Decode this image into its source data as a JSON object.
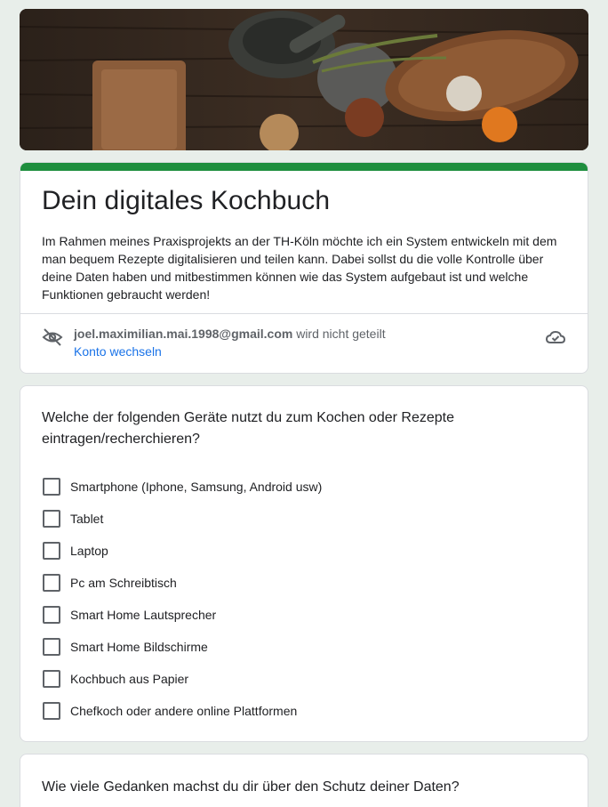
{
  "header": {
    "title": "Dein digitales Kochbuch",
    "description": "Im Rahmen meines Praxisprojekts an der TH-Köln möchte ich ein System entwickeln mit dem man bequem Rezepte digitalisieren und teilen kann. Dabei sollst du die volle Kontrolle über deine Daten haben und mitbestimmen können wie das System aufgebaut ist und welche Funktionen gebraucht werden!",
    "accent_color": "#1e8e3e"
  },
  "account": {
    "email": "joel.maximilian.mai.1998@gmail.com",
    "status": "wird nicht geteilt",
    "switch_label": "Konto wechseln",
    "icons": [
      "eye-off-icon",
      "cloud-done-icon"
    ]
  },
  "question1": {
    "title": "Welche der folgenden Geräte nutzt du zum Kochen oder Rezepte eintragen/recherchieren?",
    "options": [
      "Smartphone (Iphone, Samsung, Android usw)",
      "Tablet",
      "Laptop",
      "Pc am Schreibtisch",
      "Smart Home Lautsprecher",
      "Smart Home Bildschirme",
      "Kochbuch aus Papier",
      "Chefkoch oder andere online Plattformen"
    ]
  },
  "question2": {
    "title": "Wie viele Gedanken machst du dir über den Schutz deiner Daten?"
  }
}
